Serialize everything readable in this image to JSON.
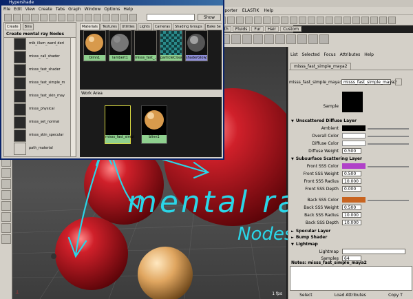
{
  "hypershade": {
    "title": "Hypershade",
    "menu": [
      "File",
      "Edit",
      "View",
      "Create",
      "Tabs",
      "Graph",
      "Window",
      "Options",
      "Help"
    ],
    "show_label": "Show",
    "left_tabs": [
      "Create",
      "Bins"
    ],
    "category_label": "Create mental ray Nodes",
    "nodes": [
      "mib_illum_ward_deri",
      "misss_call_shader",
      "misss_fast_shader",
      "misss_fast_simple_m",
      "misss_fast_skin_may",
      "misss_physical",
      "misss_set_normal",
      "misss_skin_specular",
      "path_material"
    ],
    "right_tabs": [
      "Materials",
      "Textures",
      "Utilities",
      "Lights",
      "Cameras",
      "Shading Groups",
      "Bake Se"
    ],
    "materials": [
      {
        "name": "blinn1",
        "swatch": "gold"
      },
      {
        "name": "lambert1",
        "swatch": "gray"
      },
      {
        "name": "misss_fast_...",
        "swatch": "black"
      },
      {
        "name": "particleCloud1",
        "swatch": "checker"
      },
      {
        "name": "shaderGlow1",
        "swatch": "glow"
      }
    ],
    "work_area_label": "Work Area",
    "work_nodes": [
      {
        "name": "misss_fast_simpl",
        "swatch": "black"
      },
      {
        "name": "blinn1",
        "swatch": "gold"
      }
    ]
  },
  "main": {
    "menu": [
      "Exporter",
      "ELASTIK",
      "Help"
    ],
    "shelf_tabs": [
      "oth",
      "Fluids",
      "Fur",
      "Hair",
      "Custom"
    ],
    "viewport_fps": "1 fps"
  },
  "annotation": {
    "line1": "mental ray",
    "line2": "Nodes"
  },
  "attribute_editor": {
    "menu": [
      "List",
      "Selected",
      "Focus",
      "Attributes",
      "Help"
    ],
    "tab": "misss_fast_simple_maya2",
    "node_label": "misss_fast_simple_maya:",
    "node_value": "misss_fast_simple_maya2",
    "sample_label": "Sample",
    "sections": {
      "unscattered": "Unscattered Diffuse Layer",
      "subsurface": "Subsurface Scattering Layer",
      "specular": "Specular Layer",
      "bump": "Bump Shader",
      "lightmap": "Lightmap"
    },
    "fields": {
      "ambient": "Ambient",
      "overall_color": "Overall Color",
      "diffuse_color": "Diffuse Color",
      "diffuse_weight": "Diffuse Weight",
      "diffuse_weight_val": "0.500",
      "front_sss_color": "Front SSS Color",
      "front_sss_weight": "Front SSS Weight",
      "front_sss_weight_val": "0.500",
      "front_sss_radius": "Front SSS Radius",
      "front_sss_radius_val": "10.000",
      "front_sss_depth": "Front SSS Depth",
      "front_sss_depth_val": "0.000",
      "back_sss_color": "Back SSS Color",
      "back_sss_weight": "Back SSS Weight",
      "back_sss_weight_val": "0.500",
      "back_sss_radius": "Back SSS Radius",
      "back_sss_radius_val": "10.000",
      "back_sss_depth": "Back SSS Depth",
      "back_sss_depth_val": "10.000",
      "lightmap": "Lightmap",
      "samples": "Samples",
      "samples_val": "64"
    },
    "notes_label": "Notes:  misss_fast_simple_maya2",
    "buttons": [
      "Select",
      "Load Attributes",
      "Copy T"
    ]
  },
  "colors": {
    "front_sss": "#b040c8",
    "back_sss": "#c86420",
    "annotation": "#2ad6e8",
    "sphere_red": "#b0141c"
  }
}
